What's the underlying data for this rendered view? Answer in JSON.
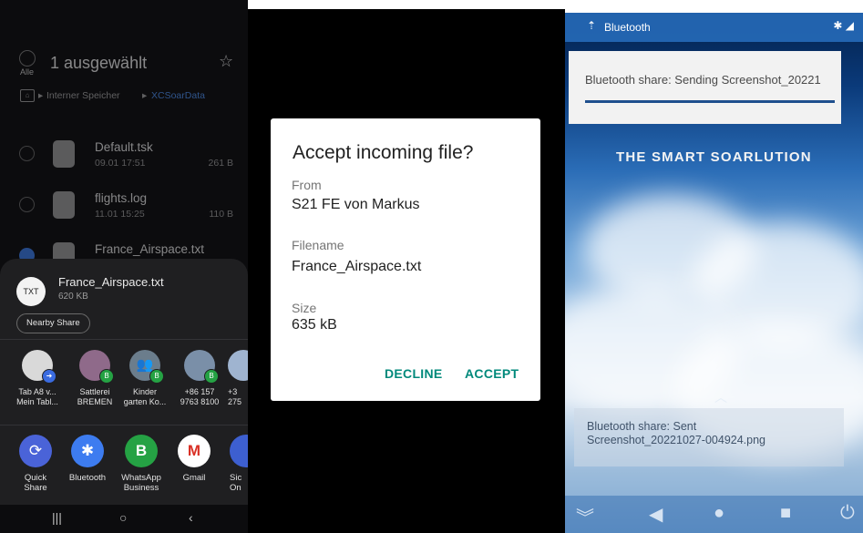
{
  "file_manager": {
    "all_label": "Alle",
    "title": "1 ausgewählt",
    "breadcrumb": [
      "Interner Speicher",
      "XCSoarData"
    ],
    "files": [
      {
        "name": "Default.tsk",
        "date": "09.01 17:51",
        "size": "261 B",
        "checked": false
      },
      {
        "name": "flights.log",
        "date": "11.01 15:25",
        "size": "110 B",
        "checked": false
      },
      {
        "name": "France_Airspace.txt",
        "date": "",
        "size": "",
        "checked": true
      }
    ]
  },
  "share_sheet": {
    "file_icon_text": "TXT",
    "file_name": "France_Airspace.txt",
    "file_size": "620 KB",
    "nearby_share_label": "Nearby Share",
    "contacts": [
      {
        "line1": "Tab A8 v...",
        "line2": "Mein Tabl..."
      },
      {
        "line1": "Sattlerei",
        "line2": "BREMEN"
      },
      {
        "line1": "Kinder",
        "line2": "garten Ko..."
      },
      {
        "line1": "+86 157",
        "line2": "9763 8100"
      },
      {
        "line1": "+3",
        "line2": "275"
      }
    ],
    "apps": [
      {
        "line1": "Quick",
        "line2": "Share"
      },
      {
        "line1": "Bluetooth",
        "line2": ""
      },
      {
        "line1": "WhatsApp",
        "line2": "Business"
      },
      {
        "line1": "Gmail",
        "line2": ""
      },
      {
        "line1": "Sic",
        "line2": "On"
      }
    ]
  },
  "dialog": {
    "title": "Accept incoming file?",
    "from_label": "From",
    "from_value": "S21 FE von Markus",
    "filename_label": "Filename",
    "filename_value": "France_Airspace.txt",
    "size_label": "Size",
    "size_value": "635 kB",
    "decline_label": "DECLINE",
    "accept_label": "ACCEPT"
  },
  "device": {
    "status_title": "Bluetooth",
    "sending_notification": "Bluetooth share: Sending Screenshot_20221",
    "logo_text": "THE SMART SOARLUTION",
    "sent_line1": "Bluetooth share: Sent",
    "sent_line2": "Screenshot_20221027-004924.png"
  },
  "colors": {
    "dialog_accent": "#00897b",
    "selection_blue": "#3b7be8",
    "sheet_background": "#1f1f21"
  }
}
